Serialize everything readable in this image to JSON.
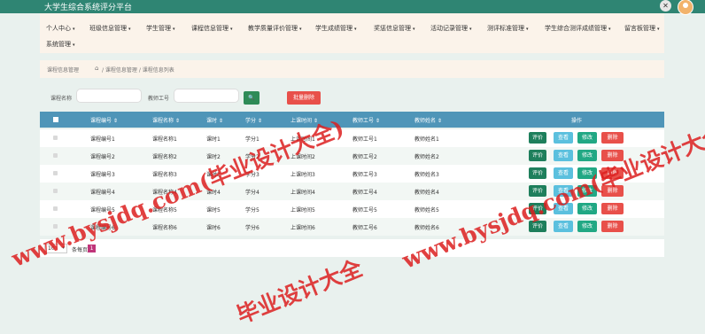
{
  "app": {
    "title": "大学生综合系统评分平台",
    "close_glyph": "✕"
  },
  "nav": [
    {
      "label": "个人中心"
    },
    {
      "label": "班级信息管理"
    },
    {
      "label": "学生管理"
    },
    {
      "label": "课程信息管理"
    },
    {
      "label": "教学质量评价管理"
    },
    {
      "label": "学生成绩管理"
    },
    {
      "label": "奖惩信息管理"
    },
    {
      "label": "活动记录管理"
    },
    {
      "label": "测评标准管理"
    },
    {
      "label": "学生综合测评成绩管理"
    },
    {
      "label": "留言板管理"
    },
    {
      "label": "系统管理"
    }
  ],
  "breadcrumb": {
    "root": "课程信息管理",
    "home_icon": "⌂",
    "path": "/ 课程信息管理 / 课程信息列表"
  },
  "search": {
    "name_label": "课程名称",
    "name_value": "",
    "teacher_label": "教师工号",
    "teacher_value": "",
    "search_icon": "🔍",
    "batch_delete": "批量删除"
  },
  "table": {
    "headers": [
      "课程编号",
      "课程名称",
      "课时",
      "学分",
      "上课时间",
      "教师工号",
      "教师姓名",
      "操作"
    ],
    "rows": [
      {
        "code": "课程编号1",
        "name": "课程名称1",
        "hours": "课时1",
        "credit": "学分1",
        "time": "上课时间1",
        "tid": "教师工号1",
        "tname": "教师姓名1"
      },
      {
        "code": "课程编号2",
        "name": "课程名称2",
        "hours": "课时2",
        "credit": "学分2",
        "time": "上课时间2",
        "tid": "教师工号2",
        "tname": "教师姓名2"
      },
      {
        "code": "课程编号3",
        "name": "课程名称3",
        "hours": "课时3",
        "credit": "学分3",
        "time": "上课时间3",
        "tid": "教师工号3",
        "tname": "教师姓名3"
      },
      {
        "code": "课程编号4",
        "name": "课程名称4",
        "hours": "课时4",
        "credit": "学分4",
        "time": "上课时间4",
        "tid": "教师工号4",
        "tname": "教师姓名4"
      },
      {
        "code": "课程编号5",
        "name": "课程名称5",
        "hours": "课时5",
        "credit": "学分5",
        "time": "上课时间5",
        "tid": "教师工号5",
        "tname": "教师姓名5"
      },
      {
        "code": "课程编号6",
        "name": "课程名称6",
        "hours": "课时6",
        "credit": "学分6",
        "time": "上课时间6",
        "tid": "教师工号6",
        "tname": "教师姓名6"
      }
    ],
    "actions": {
      "rate": "评价",
      "view": "查看",
      "edit": "修改",
      "delete": "删除"
    }
  },
  "pager": {
    "page_size": "10",
    "per_page_label": "条每页",
    "current_page": "1"
  },
  "watermark": {
    "line1": "www.bysjdq.com(毕业设计大全)",
    "line2": "毕业设计大全"
  },
  "colors": {
    "topbar": "#2f8573",
    "nav_bg": "#fbf3ea",
    "table_head": "#4f95b8",
    "rate": "#1e7f5c",
    "view": "#5bc0de",
    "edit": "#21a884",
    "delete": "#e8504a"
  }
}
